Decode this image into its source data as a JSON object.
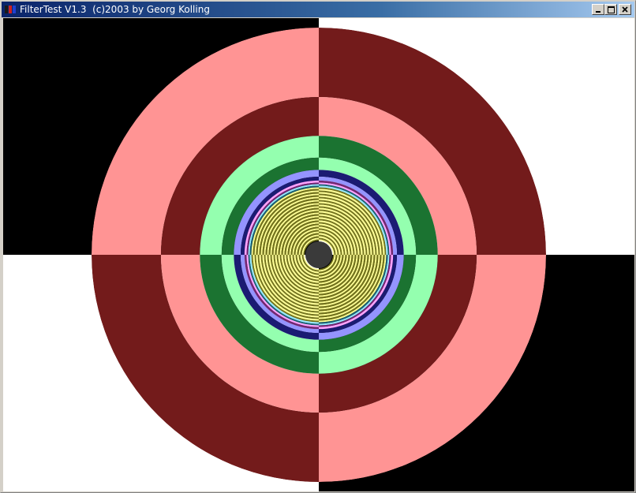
{
  "window": {
    "title": "FilterTest V1.3  (c)2003 by Georg Kolling",
    "buttons": [
      {
        "name": "minimize-button",
        "icon": "minimize-icon"
      },
      {
        "name": "maximize-button",
        "icon": "maximize-icon"
      },
      {
        "name": "close-button",
        "icon": "close-icon"
      }
    ]
  },
  "colors": {
    "titlebar_start": "#0a246a",
    "titlebar_end": "#a6caf0",
    "frame": "#d4d0c8"
  },
  "test_pattern": {
    "ring_colors": [
      "#ff3c3c",
      "#3cff6e",
      "#3c3cff",
      "#ff55ff",
      "#3cd7ff",
      "#ffff3c"
    ],
    "center_color": "#3a3a3a"
  }
}
